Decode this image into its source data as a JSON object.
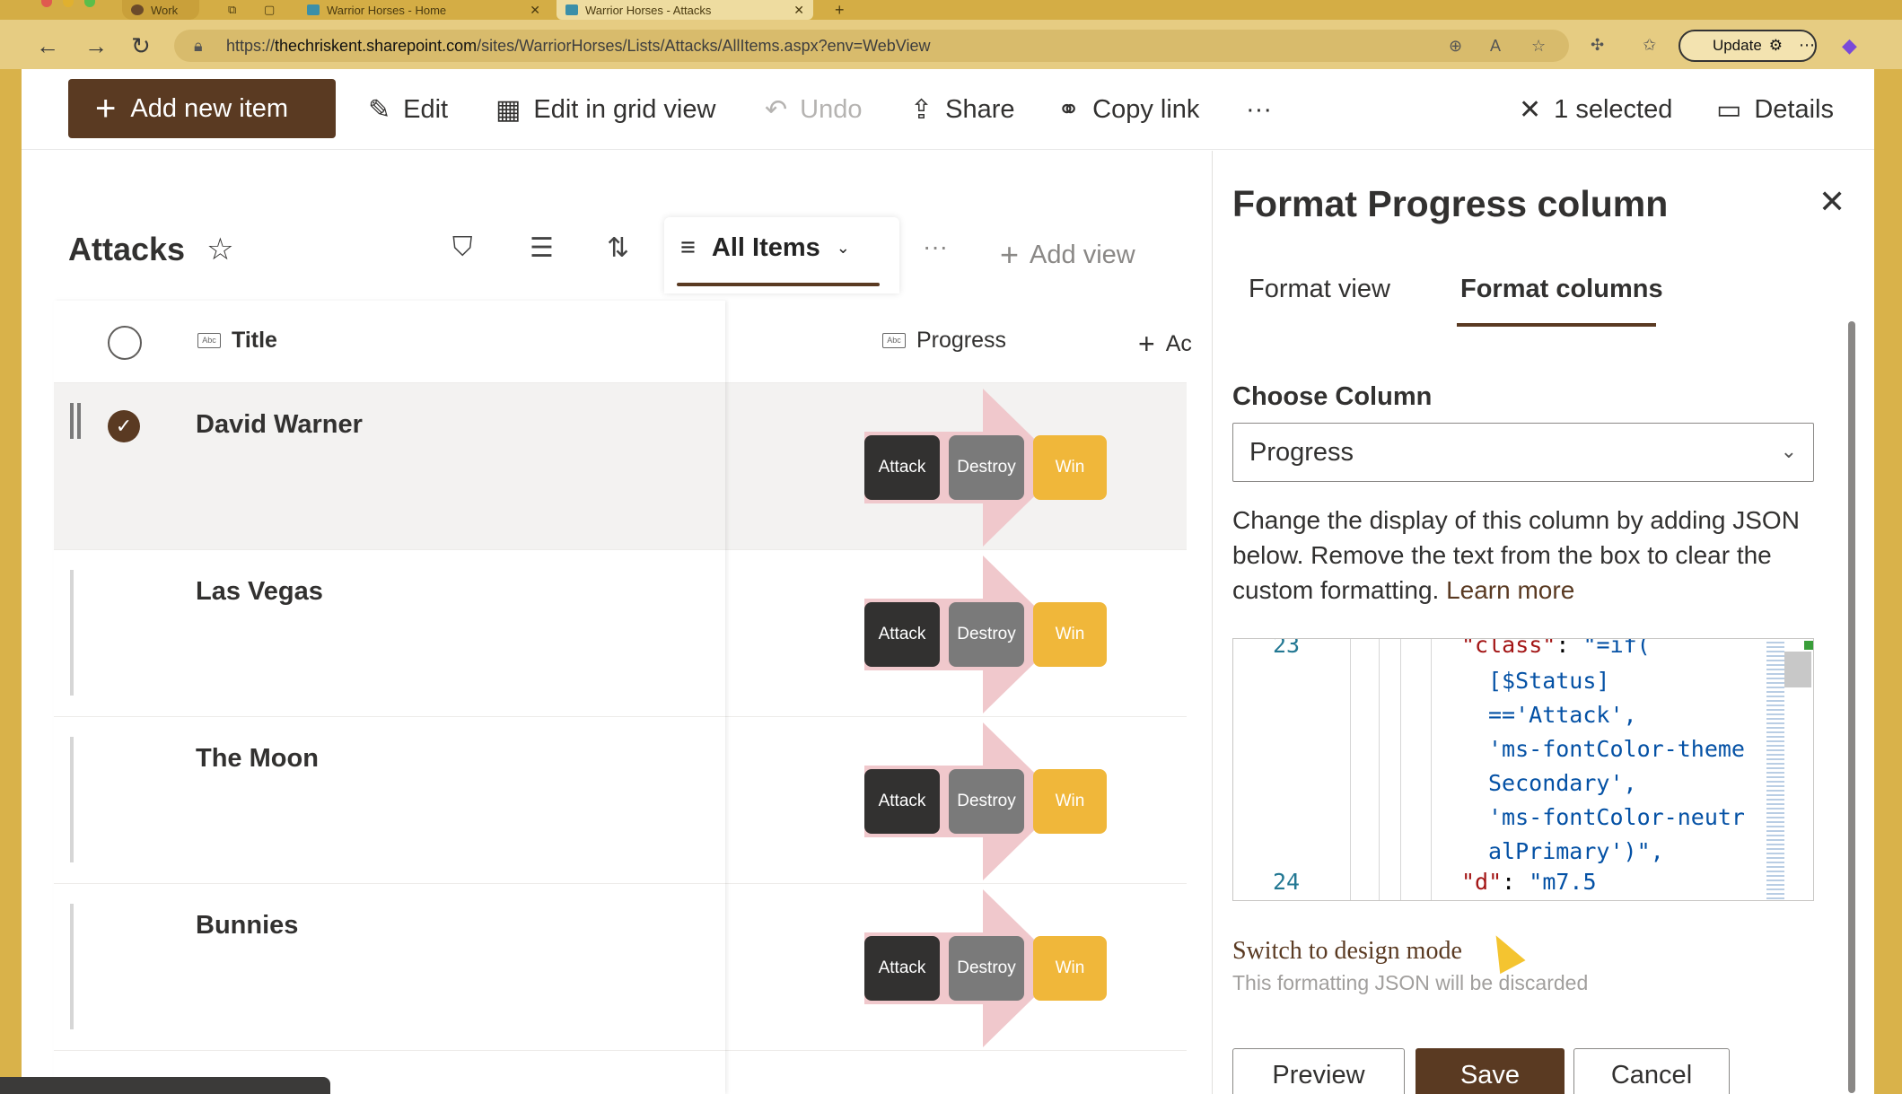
{
  "browser": {
    "tabs": [
      {
        "label": "Work"
      },
      {
        "label": "Warrior Horses - Home"
      },
      {
        "label": "Warrior Horses - Attacks"
      }
    ],
    "url_prefix": "https://",
    "url_host": "thechriskent.sharepoint.com",
    "url_path": "/sites/WarriorHorses/Lists/Attacks/AllItems.aspx?env=WebView",
    "update_label": "Update"
  },
  "toolbar": {
    "add_new_label": "Add new item",
    "edit_label": "Edit",
    "grid_label": "Edit in grid view",
    "undo_label": "Undo",
    "share_label": "Share",
    "copy_link_label": "Copy link",
    "more_label": "···",
    "selected_label": "1 selected",
    "details_label": "Details"
  },
  "list": {
    "title": "Attacks",
    "view_name": "All Items",
    "more_label": "···",
    "add_view_label": "Add view",
    "columns": {
      "title": "Title",
      "progress": "Progress",
      "add": "Ac"
    },
    "rows": [
      {
        "title": "David Warner",
        "selected": true
      },
      {
        "title": "Las Vegas",
        "selected": false
      },
      {
        "title": "The Moon",
        "selected": false
      },
      {
        "title": "Bunnies",
        "selected": false
      }
    ],
    "progress_labels": {
      "attack": "Attack",
      "destroy": "Destroy",
      "win": "Win"
    }
  },
  "panel": {
    "title": "Format Progress column",
    "tabs": {
      "format_view": "Format view",
      "format_columns": "Format columns"
    },
    "choose_column_label": "Choose Column",
    "selected_column": "Progress",
    "description": "Change the display of this column by adding JSON below. Remove the text from the box to clear the custom formatting.",
    "learn_more": "Learn more",
    "editor": {
      "line_23": "23",
      "line_24": "24",
      "code_1_key": "\"class\"",
      "code_1_rest": ": ",
      "code_1_val": "\"=if(",
      "code_2": "[$Status]",
      "code_3": "=='Attack',",
      "code_4": "'ms-fontColor-theme",
      "code_5": "Secondary',",
      "code_6": "'ms-fontColor-neutr",
      "code_7": "alPrimary')\",",
      "code_8_key": "\"d\"",
      "code_8_val": "\"m7.5"
    },
    "switch_label": "Switch to design mode",
    "switch_sub": "This formatting JSON will be discarded",
    "preview_label": "Preview",
    "save_label": "Save",
    "cancel_label": "Cancel"
  },
  "colors": {
    "brand": "#5a3a22",
    "browser_chrome": "#d9b24a",
    "attack": "#323130",
    "destroy": "#7a7a7a",
    "win": "#f0b73a",
    "arrow": "#f0c8cc"
  }
}
